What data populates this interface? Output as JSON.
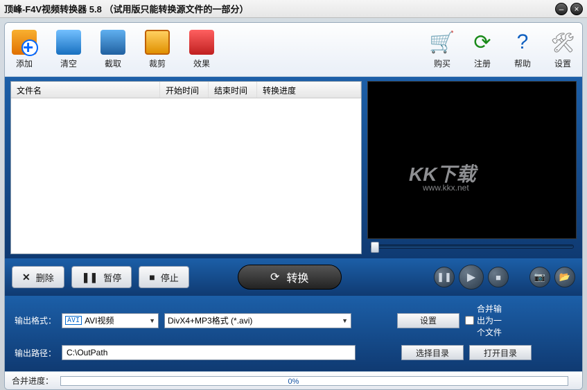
{
  "title": "顶峰-F4V视频转换器 5.8 （试用版只能转换源文件的一部分）",
  "toolbar": {
    "left": [
      {
        "name": "add",
        "label": "添加"
      },
      {
        "name": "clear",
        "label": "清空"
      },
      {
        "name": "capture",
        "label": "截取"
      },
      {
        "name": "crop",
        "label": "裁剪"
      },
      {
        "name": "effects",
        "label": "效果"
      }
    ],
    "right": [
      {
        "name": "buy",
        "label": "购买"
      },
      {
        "name": "register",
        "label": "注册"
      },
      {
        "name": "help",
        "label": "帮助"
      },
      {
        "name": "settings",
        "label": "设置"
      }
    ]
  },
  "file_columns": {
    "name": "文件名",
    "start": "开始时间",
    "end": "结束时间",
    "progress": "转换进度"
  },
  "controls": {
    "delete": "删除",
    "pause": "暂停",
    "stop": "停止",
    "convert": "转换"
  },
  "output": {
    "format_label": "输出格式：",
    "format_value": "AVI视频",
    "format_detail": "DivX4+MP3格式 (*.avi)",
    "settings_btn": "设置",
    "merge_label": "合并输出为一个文件",
    "path_label": "输出路径：",
    "path_value": "C:\\OutPath",
    "choose_dir": "选择目录",
    "open_dir": "打开目录"
  },
  "footer": {
    "label": "合并进度：",
    "percent": "0%"
  },
  "watermark": {
    "brand": "KK下载",
    "url": "www.kkx.net"
  }
}
